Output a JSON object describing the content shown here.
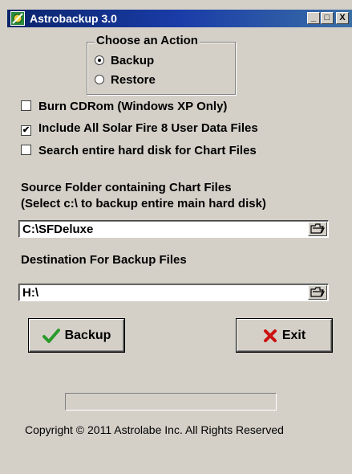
{
  "window": {
    "title": "Astrobackup 3.0",
    "min_glyph": "_",
    "max_glyph": "□",
    "close_glyph": "X"
  },
  "action_group": {
    "legend": "Choose an Action",
    "options": [
      {
        "label": "Backup",
        "selected": true
      },
      {
        "label": "Restore",
        "selected": false
      }
    ]
  },
  "checkboxes": [
    {
      "label": "Burn CDRom (Windows XP Only)",
      "checked": false
    },
    {
      "label": "Include All Solar Fire 8 User Data Files",
      "checked": true
    },
    {
      "label": "Search entire hard disk for Chart Files",
      "checked": false
    }
  ],
  "source": {
    "label_line1": "Source Folder containing Chart Files",
    "label_line2": "(Select c:\\ to backup entire main hard disk)",
    "value": "C:\\SFDeluxe"
  },
  "destination": {
    "label": "Destination For Backup Files",
    "value": "H:\\"
  },
  "buttons": {
    "backup_label": "Backup",
    "exit_label": "Exit"
  },
  "progress": {
    "fraction": 0
  },
  "footer": {
    "copyright": "Copyright © 2011 Astrolabe Inc. All Rights Reserved"
  },
  "colors": {
    "titlebar": "#0a246a",
    "check_icon": "#2a9a2a",
    "exit_icon": "#cc1111",
    "face": "#d4d0c8"
  }
}
